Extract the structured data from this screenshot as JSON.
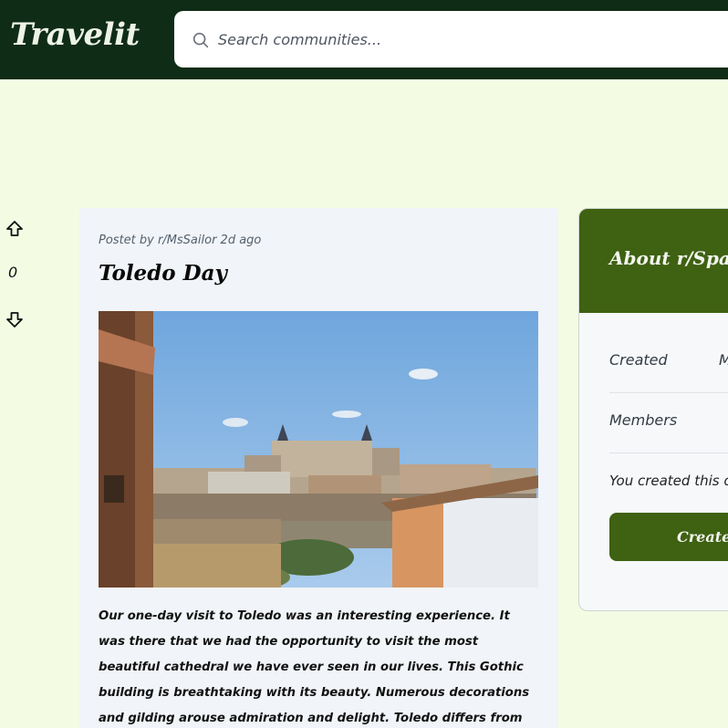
{
  "header": {
    "logo": "Travelit",
    "search": {
      "placeholder": "Search communities..."
    }
  },
  "votes": {
    "count": "0"
  },
  "post": {
    "meta": "Postet by r/MsSailor 2d ago",
    "title": "Toledo Day",
    "image_alt": "Toledo cityscape",
    "body": "Our one-day visit to Toledo was an interesting experience. It was there that we had the opportunity to visit the most beautiful cathedral we have ever seen in our lives. This Gothic building is breathtaking with its beauty. Numerous decorations and gilding arouse admiration and delight. Toledo differs from Madrid in its architecture and is certainly"
  },
  "about": {
    "title": "About r/Spain",
    "created_label": "Created",
    "created_value": "M",
    "members_label": "Members",
    "note": "You created this c",
    "create_button": "Create"
  },
  "colors": {
    "topbar": "#0f2c16",
    "page_bg": "#f3fbe3",
    "accent_green": "#3f6112"
  }
}
